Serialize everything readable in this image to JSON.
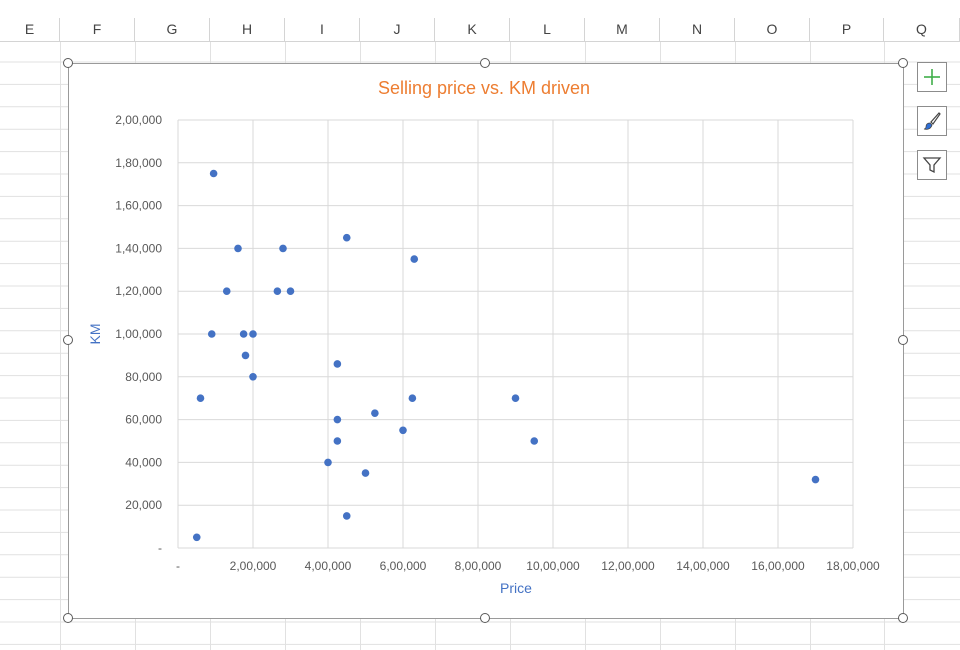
{
  "spreadsheet": {
    "columns": [
      "E",
      "F",
      "G",
      "H",
      "I",
      "J",
      "K",
      "L",
      "M",
      "N",
      "O",
      "P",
      "Q"
    ]
  },
  "chart_tools": {
    "add_element_icon": "plus-icon",
    "style_icon": "brush-icon",
    "filter_icon": "funnel-icon"
  },
  "chart_data": {
    "type": "scatter",
    "title": "Selling price vs. KM driven",
    "xlabel": "Price",
    "ylabel": "KM",
    "xlim": [
      0,
      1800000
    ],
    "ylim": [
      0,
      200000
    ],
    "x_tick_labels": [
      "-",
      "2,00,000",
      "4,00,000",
      "6,00,000",
      "8,00,000",
      "10,00,000",
      "12,00,000",
      "14,00,000",
      "16,00,000",
      "18,00,000"
    ],
    "y_tick_labels": [
      "-",
      "20,000",
      "40,000",
      "60,000",
      "80,000",
      "1,00,000",
      "1,20,000",
      "1,40,000",
      "1,60,000",
      "1,80,000",
      "2,00,000"
    ],
    "grid": true,
    "legend": "none",
    "colors": {
      "title": "#ED7D31",
      "axis_title": "#4472C4",
      "marker": "#4472C4"
    },
    "series": [
      {
        "points": [
          [
            50000,
            5000
          ],
          [
            60000,
            70000
          ],
          [
            95000,
            175000
          ],
          [
            90000,
            100000
          ],
          [
            130000,
            120000
          ],
          [
            160000,
            140000
          ],
          [
            175000,
            100000
          ],
          [
            180000,
            90000
          ],
          [
            200000,
            100000
          ],
          [
            200000,
            80000
          ],
          [
            265000,
            120000
          ],
          [
            280000,
            140000
          ],
          [
            300000,
            120000
          ],
          [
            400000,
            40000
          ],
          [
            425000,
            86000
          ],
          [
            425000,
            60000
          ],
          [
            425000,
            50000
          ],
          [
            450000,
            145000
          ],
          [
            450000,
            15000
          ],
          [
            500000,
            35000
          ],
          [
            525000,
            63000
          ],
          [
            600000,
            55000
          ],
          [
            625000,
            70000
          ],
          [
            630000,
            135000
          ],
          [
            900000,
            70000
          ],
          [
            950000,
            50000
          ],
          [
            1700000,
            32000
          ]
        ]
      }
    ]
  }
}
